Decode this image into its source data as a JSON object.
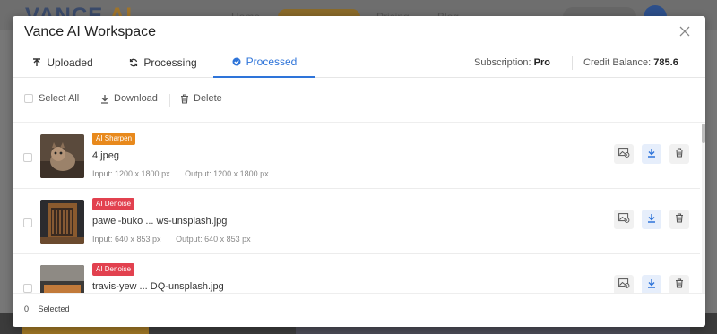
{
  "background": {
    "logo": "VANCE AI",
    "logo_brand": "VANCE ",
    "logo_ai": "AI",
    "nav_items": [
      "Home",
      "AI Solutions",
      "Pricing",
      "Blog"
    ],
    "sign_in": "Log in",
    "avatar_letter": "+"
  },
  "modal": {
    "title": "Vance AI Workspace",
    "close_icon": "close-icon"
  },
  "tabs": [
    {
      "label": "Uploaded",
      "icon": "upload-icon",
      "active": false
    },
    {
      "label": "Processing",
      "icon": "refresh-icon",
      "active": false
    },
    {
      "label": "Processed",
      "icon": "check-circle-icon",
      "active": true
    }
  ],
  "subscription": {
    "label": "Subscription:",
    "value": "Pro"
  },
  "credit": {
    "label": "Credit Balance:",
    "value": "785.6"
  },
  "toolbar": {
    "select_all": "Select All",
    "download": "Download",
    "delete": "Delete"
  },
  "items": [
    {
      "badge": "AI Sharpen",
      "badge_color": "#e8891c",
      "filename": "4.jpeg",
      "input": "Input: 1200 x 1800 px",
      "output": "Output: 1200 x 1800 px"
    },
    {
      "badge": "AI Denoise",
      "badge_color": "#e2414f",
      "filename": "pawel-buko ... ws-unsplash.jpg",
      "input": "Input: 640 x 853 px",
      "output": "Output: 640 x 853 px"
    },
    {
      "badge": "AI Denoise",
      "badge_color": "#e2414f",
      "filename": "travis-yew ... DQ-unsplash.jpg",
      "input": "",
      "output": ""
    }
  ],
  "footer": {
    "selected_count": "0",
    "selected_label": "Selected"
  },
  "colors": {
    "accent": "#2e74d9",
    "sharpen": "#e8891c",
    "denoise": "#e2414f"
  }
}
